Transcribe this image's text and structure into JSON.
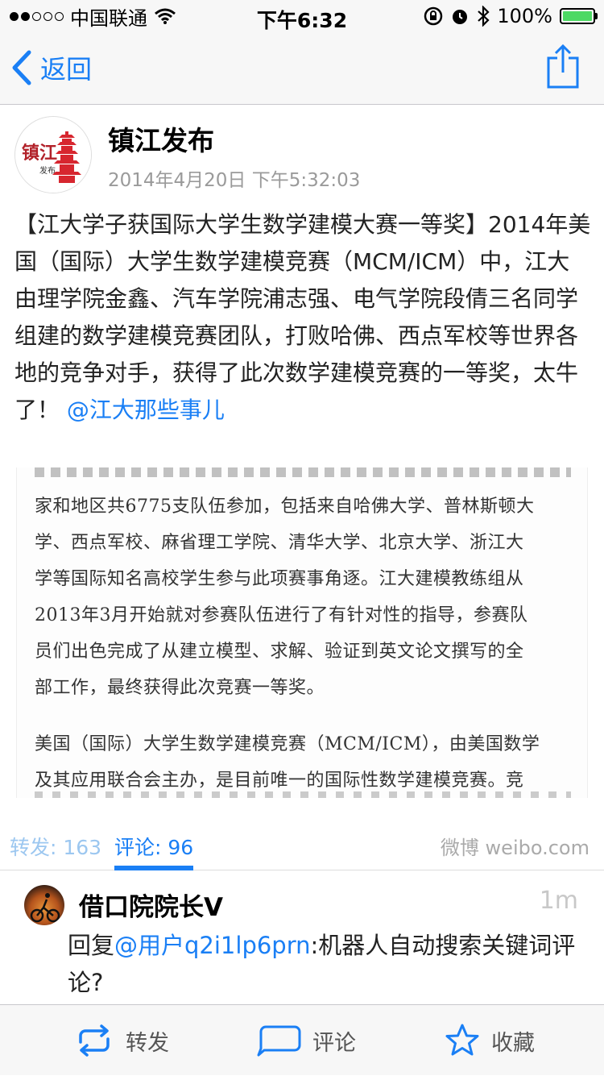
{
  "status_bar": {
    "carrier": "中国联通",
    "time": "下午6:32",
    "battery_percent": "100%"
  },
  "nav": {
    "back_label": "返回",
    "icons": {
      "back": "chevron-left-icon",
      "share": "share-icon"
    },
    "accent_color": "#1a7ff5"
  },
  "post": {
    "author": "镇江发布",
    "avatar_text": {
      "line1": "镇江",
      "line2": "发布"
    },
    "time": "2014年4月20日 下午5:32:03",
    "text": "【江大学子获国际大学生数学建模大赛一等奖】2014年美国（国际）大学生数学建模竞赛（MCM/ICM）中，江大由理学院金鑫、汽车学院浦志强、电气学院段倩三名同学组建的数学建模竞赛团队，打败哈佛、西点军校等世界各地的竞争对手，获得了此次数学建模竞赛的一等奖，太牛了！",
    "mention": "@江大那些事儿",
    "image_lines": [
      "家和地区共6775支队伍参加，包括来自哈佛大学、普林斯顿大",
      "学、西点军校、麻省理工学院、清华大学、北京大学、浙江大",
      "学等国际知名高校学生参与此项赛事角逐。江大建模教练组从",
      "2013年3月开始就对参赛队伍进行了有针对性的指导，参赛队",
      "员们出色完成了从建立模型、求解、验证到英文论文撰写的全",
      "部工作，最终获得此次竞赛一等奖。",
      "美国（国际）大学生数学建模竞赛（MCM/ICM），由美国数学",
      "及其应用联合会主办，是目前唯一的国际性数学建模竞赛。竞"
    ]
  },
  "stats": {
    "repost_label": "转发: 163",
    "comments_label": "评论: 96",
    "source": "微博 weibo.com"
  },
  "comment": {
    "author": "借口院院长V",
    "time": "1m",
    "reply_prefix": "回复",
    "mention": "@用户q2i1lp6prn",
    "text": ":机器人自动搜索关键词评论?"
  },
  "toolbar": {
    "repost": "转发",
    "comment": "评论",
    "favorite": "收藏",
    "icons": {
      "repost": "repost-icon",
      "comment": "comment-icon",
      "favorite": "star-icon"
    }
  }
}
